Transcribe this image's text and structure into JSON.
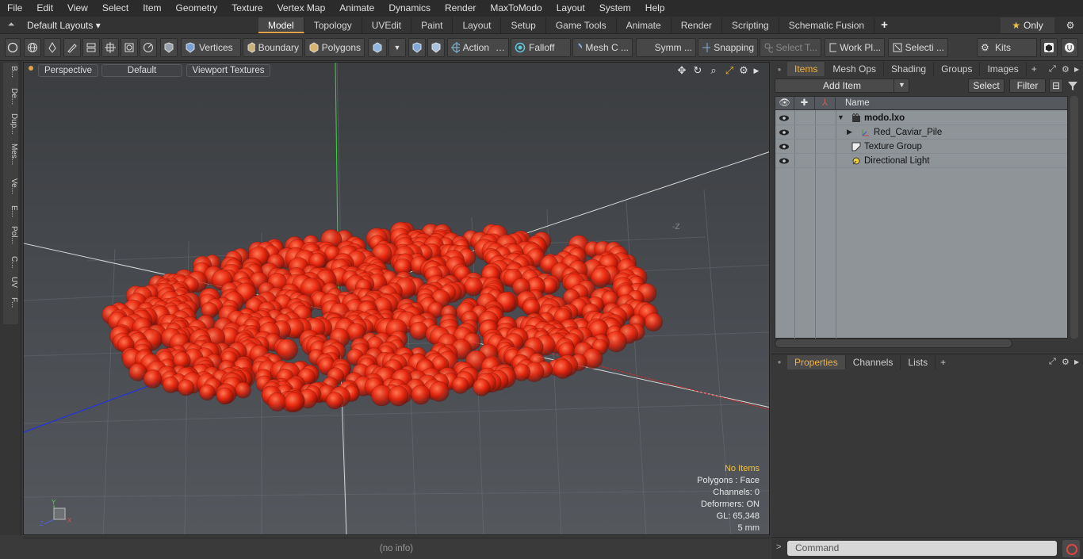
{
  "menu": [
    "File",
    "Edit",
    "View",
    "Select",
    "Item",
    "Geometry",
    "Texture",
    "Vertex Map",
    "Animate",
    "Dynamics",
    "Render",
    "MaxToModo",
    "Layout",
    "System",
    "Help"
  ],
  "layoutbar": {
    "layouts": "Default Layouts ▾",
    "tabs": [
      "Model",
      "Topology",
      "UVEdit",
      "Paint",
      "Layout",
      "Setup",
      "Game Tools",
      "Animate",
      "Render",
      "Scripting",
      "Schematic Fusion"
    ],
    "active_tab": "Model",
    "only": "Only",
    "accent": "#e0a24a"
  },
  "toolbar": {
    "vertices": "Vertices",
    "boundary": "Boundary",
    "polygons": "Polygons",
    "action": "Action",
    "falloff": "Falloff",
    "mesh": "Mesh C ...",
    "symm": "Symm ...",
    "snapping": "Snapping",
    "select_t": "Select T...",
    "work_pl": "Work Pl...",
    "selecti": "Selecti ...",
    "kits": "Kits"
  },
  "left_tabs": [
    "B...",
    "De...",
    "Dup...",
    "Mes...",
    "Ve...",
    "E...",
    "Pol...",
    "C...",
    "UV",
    "F..."
  ],
  "viewport": {
    "perspective": "Perspective",
    "default": "Default",
    "viewport_textures": "Viewport Textures",
    "z_label": "-Z",
    "info": {
      "no_items": "No Items",
      "polygons": "Polygons : Face",
      "channels": "Channels: 0",
      "deformers": "Deformers: ON",
      "gl": "GL: 65,348",
      "scale": "5 mm"
    }
  },
  "status": "(no info)",
  "items_panel": {
    "tabs": [
      "Items",
      "Mesh Ops",
      "Shading",
      "Groups",
      "Images"
    ],
    "active_tab": "Items",
    "add_item": "Add Item",
    "select": "Select",
    "filter": "Filter",
    "name_header": "Name",
    "rows": [
      {
        "name": "modo.lxo",
        "icon": "scene-icon",
        "bold": true
      },
      {
        "name": "Red_Caviar_Pile",
        "icon": "mesh-icon",
        "bold": false
      },
      {
        "name": "Texture Group",
        "icon": "texture-group-icon",
        "bold": false
      },
      {
        "name": "Directional Light",
        "icon": "light-icon",
        "bold": false
      }
    ]
  },
  "props_panel": {
    "tabs": [
      "Properties",
      "Channels",
      "Lists"
    ],
    "active_tab": "Properties"
  },
  "command": {
    "placeholder": "Command"
  }
}
